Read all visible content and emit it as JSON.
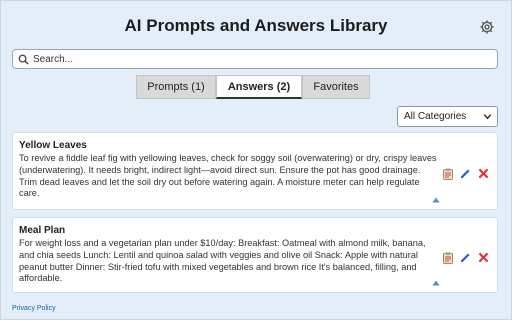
{
  "header": {
    "title": "AI Prompts and Answers Library"
  },
  "search": {
    "placeholder": "Search..."
  },
  "tabs": [
    {
      "label": "Prompts (1)",
      "active": false
    },
    {
      "label": "Answers (2)",
      "active": true
    },
    {
      "label": "Favorites",
      "active": false
    }
  ],
  "filter": {
    "selected": "All Categories"
  },
  "answers": [
    {
      "title": "Yellow Leaves",
      "body": "To revive a fiddle leaf fig with yellowing leaves, check for soggy soil (overwatering) or dry, crispy leaves (underwatering). It needs bright, indirect light—avoid direct sun. Ensure the pot has good drainage. Trim dead leaves and let the soil dry out before watering again. A moisture meter can help regulate care."
    },
    {
      "title": "Meal Plan",
      "body": "For weight loss and a vegetarian plan under $10/day:  Breakfast: Oatmeal with almond milk, banana, and chia seeds  Lunch: Lentil and quinoa salad with veggies and olive oil  Snack: Apple with natural peanut butter  Dinner: Stir-fried tofu with mixed vegetables and brown rice It's balanced, filling, and affordable."
    }
  ],
  "footer": {
    "privacy_label": "Privacy Policy"
  },
  "icons": {
    "settings": "gear-icon",
    "search": "search-icon",
    "copy": "clipboard-icon",
    "edit": "pencil-icon",
    "delete": "close-icon",
    "expand": "triangle-up-icon"
  },
  "colors": {
    "background": "#e3eef8",
    "delete": "#e0343c",
    "edit": "#2a63c4",
    "link": "#1a5fb4"
  }
}
